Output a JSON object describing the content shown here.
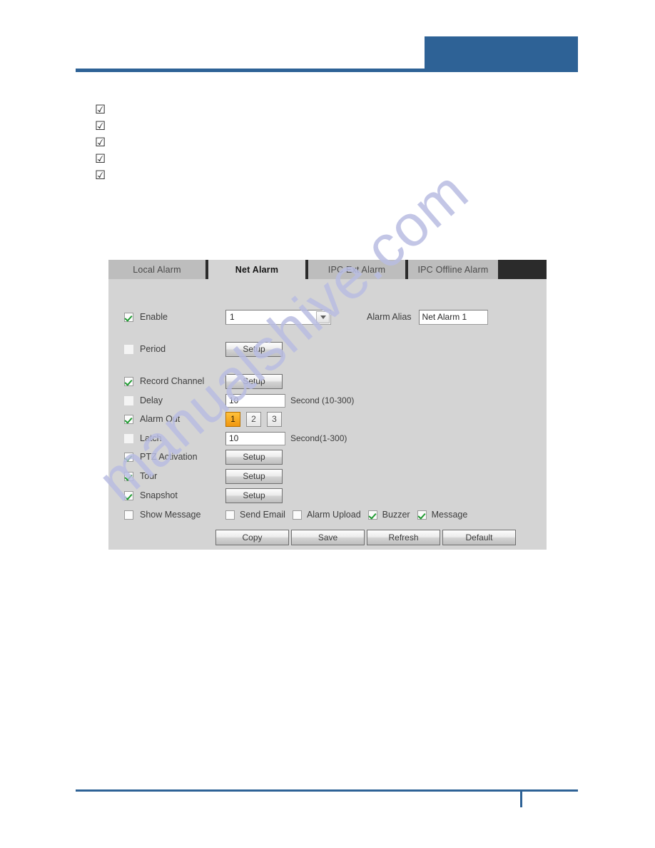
{
  "page": {
    "header": {
      "accent_color": "#2e6296"
    },
    "bullets": [
      {
        "icon": "ballot-box-with-check-icon",
        "text": ""
      },
      {
        "icon": "ballot-box-with-check-icon",
        "text": ""
      },
      {
        "icon": "ballot-box-with-check-icon",
        "text": ""
      },
      {
        "icon": "ballot-box-with-check-icon",
        "text": ""
      },
      {
        "icon": "ballot-box-with-check-icon",
        "text": ""
      }
    ],
    "bullet_glyph": "☑",
    "watermark": "manualshive.com",
    "watermark_color": "#b9bde2"
  },
  "panel": {
    "tabs": [
      {
        "label": "Local Alarm",
        "selected": false
      },
      {
        "label": "Net Alarm",
        "selected": true
      },
      {
        "label": "IPC Ext Alarm",
        "selected": false
      },
      {
        "label": "IPC Offline Alarm",
        "selected": false
      }
    ],
    "fields": {
      "enable": {
        "label": "Enable",
        "checked": true
      },
      "channel_select": {
        "value": "1",
        "icon": "chevron-down-icon"
      },
      "alarm_alias": {
        "label": "Alarm Alias",
        "value": "Net Alarm 1"
      },
      "period": {
        "label": "Period",
        "button": "Setup"
      },
      "record_channel": {
        "label": "Record Channel",
        "checked": true,
        "button": "Setup"
      },
      "delay": {
        "label": "Delay",
        "value": "10",
        "hint": "Second (10-300)"
      },
      "alarm_out": {
        "label": "Alarm Out",
        "checked": true,
        "outputs": [
          {
            "label": "1",
            "active": true
          },
          {
            "label": "2",
            "active": false
          },
          {
            "label": "3",
            "active": false
          }
        ]
      },
      "latch": {
        "label": "Latch",
        "value": "10",
        "hint": "Second(1-300)"
      },
      "ptz_activation": {
        "label": "PTZ Activation",
        "checked": true,
        "button": "Setup"
      },
      "tour": {
        "label": "Tour",
        "checked": true,
        "button": "Setup"
      },
      "snapshot": {
        "label": "Snapshot",
        "checked": true,
        "button": "Setup"
      },
      "show_message": {
        "label": "Show Message",
        "checked": false
      },
      "send_email": {
        "label": "Send Email",
        "checked": false
      },
      "alarm_upload": {
        "label": "Alarm Upload",
        "checked": false
      },
      "buzzer": {
        "label": "Buzzer",
        "checked": true
      },
      "message": {
        "label": "Message",
        "checked": true
      }
    },
    "actions": [
      {
        "label": "Copy"
      },
      {
        "label": "Save"
      },
      {
        "label": "Refresh"
      },
      {
        "label": "Default"
      }
    ],
    "colors": {
      "panel_bg": "#d4d4d4",
      "tab_inactive": "#bdbdbd",
      "tab_strip_dark": "#2b2b2b",
      "active_output": "#f0960e",
      "checkmark": "#1f9a31"
    }
  }
}
